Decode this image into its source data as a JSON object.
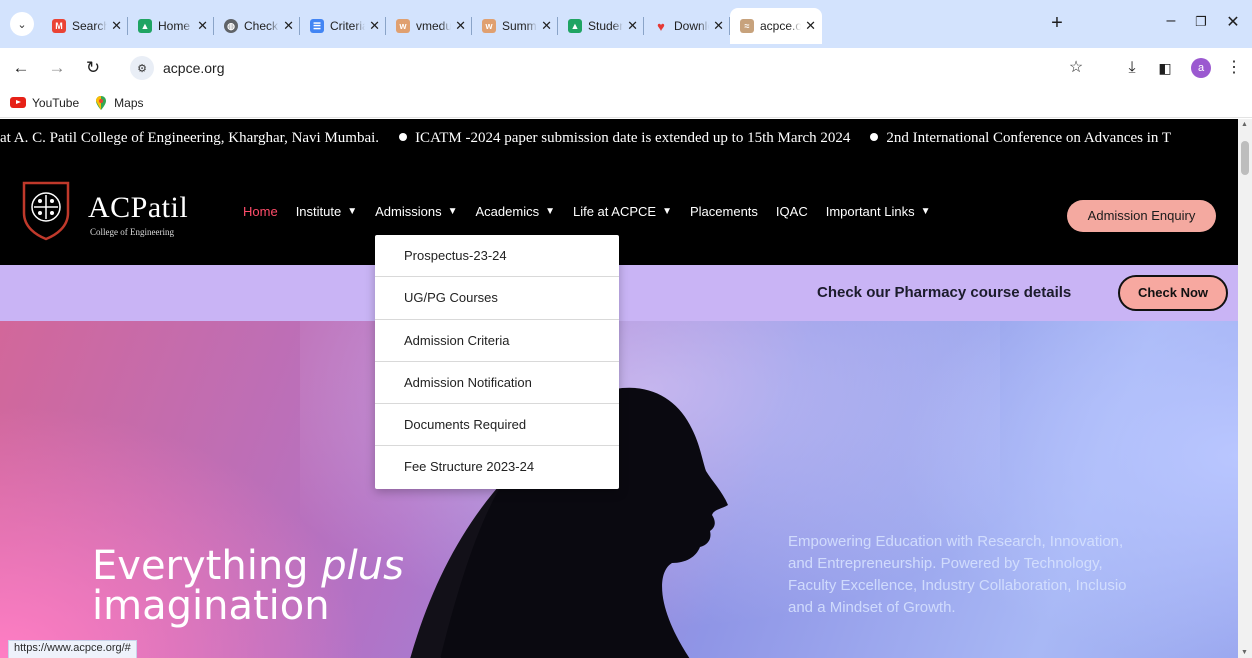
{
  "browser": {
    "tabs": [
      {
        "title": "Search r",
        "icon": "gmail-icon",
        "color": "#ea4335"
      },
      {
        "title": "Home -",
        "icon": "google-drive-icon",
        "color": "#1fa463"
      },
      {
        "title": "Check fo",
        "icon": "globe-icon",
        "color": "#5f6368"
      },
      {
        "title": "Criteria",
        "icon": "google-forms-icon",
        "color": "#4285f4"
      },
      {
        "title": "vmedul",
        "icon": "vmedulife-icon",
        "color": "#e0a070"
      },
      {
        "title": "Summa",
        "icon": "vmedulife-icon",
        "color": "#e0a070"
      },
      {
        "title": "Student",
        "icon": "google-drive-icon",
        "color": "#1fa463"
      },
      {
        "title": "Downlo",
        "icon": "heart-icon",
        "color": "#e53935"
      },
      {
        "title": "acpce.o",
        "icon": "acpce-favicon",
        "color": "#c7a27c",
        "active": true
      }
    ],
    "new_tab": "+",
    "url": "acpce.org",
    "bookmarks": [
      {
        "label": "YouTube",
        "icon": "youtube-icon"
      },
      {
        "label": "Maps",
        "icon": "maps-icon"
      }
    ],
    "profile_initial": "a",
    "status_url": "https://www.acpce.org/#"
  },
  "site": {
    "ticker": {
      "items": [
        "at A. C. Patil College of Engineering, Kharghar, Navi Mumbai.",
        "ICATM -2024 paper submission date is extended up to 15th March 2024",
        "2nd International Conference on Advances in T"
      ]
    },
    "logo": {
      "name": "ACPatil",
      "subtitle": "College of Engineering"
    },
    "nav": [
      {
        "label": "Home",
        "active": true,
        "dropdown": false
      },
      {
        "label": "Institute",
        "dropdown": true
      },
      {
        "label": "Admissions",
        "dropdown": true
      },
      {
        "label": "Academics",
        "dropdown": true
      },
      {
        "label": "Life at ACPCE",
        "dropdown": true
      },
      {
        "label": "Placements",
        "dropdown": false
      },
      {
        "label": "IQAC",
        "dropdown": false
      },
      {
        "label": "Important Links",
        "dropdown": true
      }
    ],
    "enquiry_button": "Admission Enquiry",
    "admissions_menu": [
      "Prospectus-23-24",
      "UG/PG Courses",
      "Admission Criteria",
      "Admission Notification",
      "Documents Required",
      "Fee Structure 2023-24"
    ],
    "promo": {
      "text": "Check our Pharmacy course details",
      "button": "Check Now"
    },
    "hero": {
      "title_start": "Everything",
      "title_italic": "plus",
      "title_end": "imagination",
      "copy": "Empowering Education with Research, Innovation, and Entrepreneurship. Powered by Technology, Faculty Excellence, Industry Collaboration, Inclusio and a Mindset of Growth."
    },
    "colors": {
      "accent": "#ff4d6a",
      "enquiry": "#f4a9a0",
      "promo_band": "#c9b4f5"
    }
  }
}
